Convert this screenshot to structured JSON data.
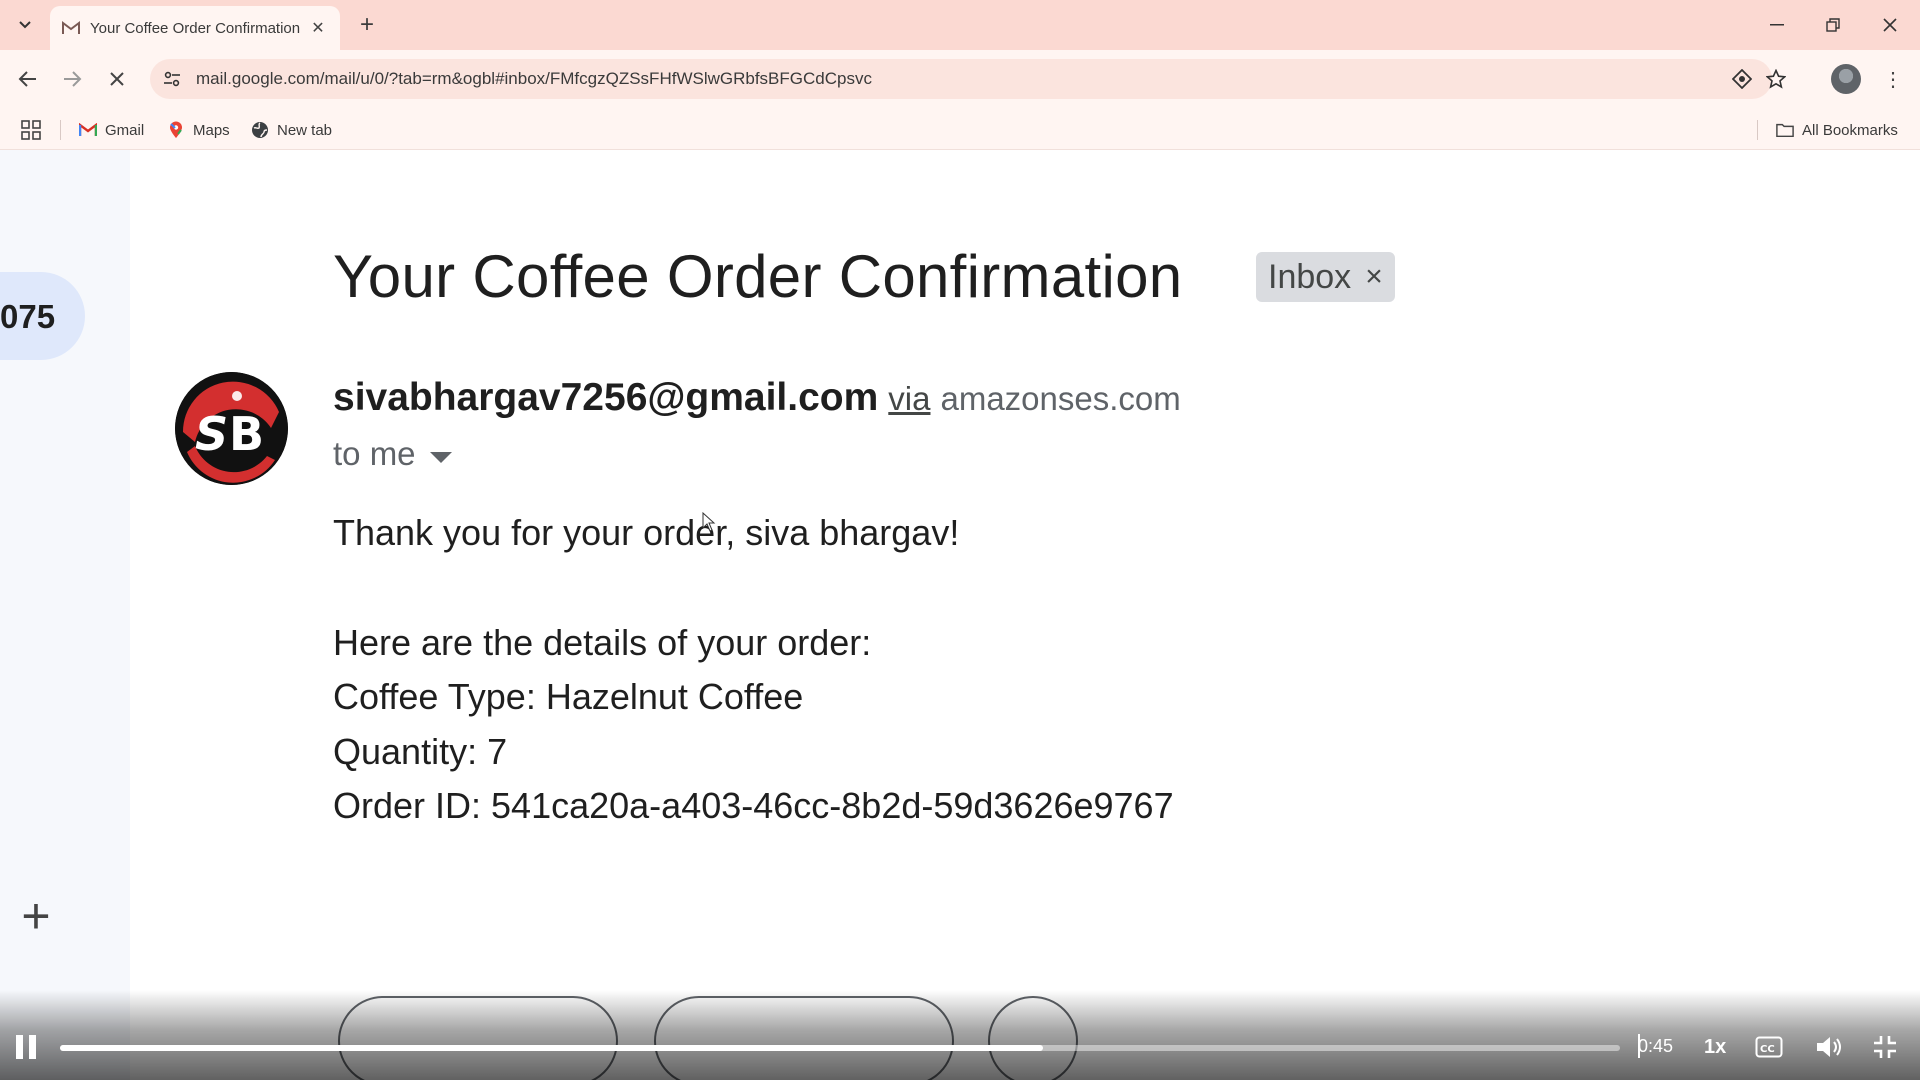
{
  "browser": {
    "tab_title": "Your Coffee Order Confirmation",
    "url": "mail.google.com/mail/u/0/?tab=rm&ogbl#inbox/FMfcgzQZSsFHfWSlwGRbfsBFGCdCpsvc",
    "bookmarks": [
      {
        "label": "Gmail",
        "icon": "gmail-icon"
      },
      {
        "label": "Maps",
        "icon": "maps-pin-icon"
      },
      {
        "label": "New tab",
        "icon": "globe-icon"
      }
    ],
    "all_bookmarks_label": "All Bookmarks"
  },
  "gmail": {
    "left_count": "075",
    "subject": "Your Coffee Order Confirmation",
    "label_chip": "Inbox",
    "sender": "sivabhargav7256@gmail.com",
    "via_label": "via",
    "via_domain": "amazonses.com",
    "recipient": "to me",
    "body_lines": [
      "Thank you for your order, siva bhargav!",
      "Here are the details of your order:",
      "Coffee Type: Hazelnut Coffee",
      "Quantity: 7",
      "Order ID: 541ca20a-a403-46cc-8b2d-59d3626e9767"
    ]
  },
  "player": {
    "time": "0:45",
    "speed": "1x",
    "progress_fraction": 0.63,
    "cc_label": "CC"
  },
  "colors": {
    "tabbar_bg": "#fbd9d2",
    "toolbar_bg": "#fff5f2",
    "rail_bg": "#f6f8fc",
    "count_pill": "#dfe8fb",
    "chip_bg": "#dadce0",
    "avatar_red": "#d32f2f"
  }
}
